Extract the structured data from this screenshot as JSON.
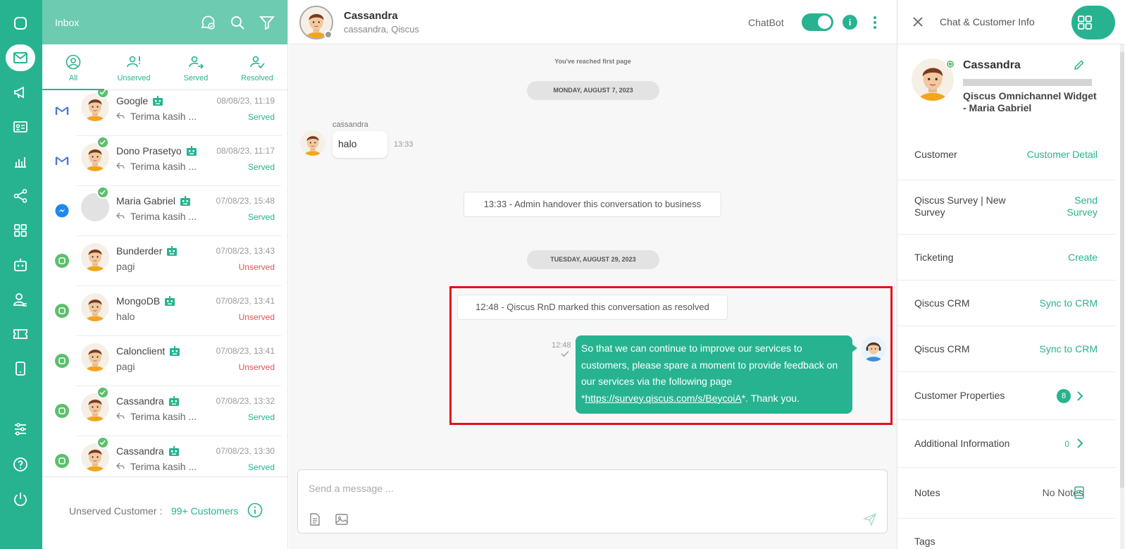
{
  "nav": {
    "items": [
      "chat-icon",
      "inbox-icon",
      "broadcast-icon",
      "contacts-icon",
      "analytics-icon",
      "integration-icon",
      "apps-icon",
      "bot-icon",
      "agent-icon",
      "ticket-icon",
      "mobile-icon",
      "settings-icon",
      "help-icon",
      "logout-icon"
    ]
  },
  "inbox": {
    "title": "Inbox",
    "tabs": [
      {
        "label": "All"
      },
      {
        "label": "Unserved"
      },
      {
        "label": "Served"
      },
      {
        "label": "Resolved"
      }
    ],
    "rooms": [
      {
        "name": "Google",
        "time": "08/08/23, 11:19",
        "preview": "Terima kasih ...",
        "status": "Served",
        "channel": "gmail",
        "resolved": true
      },
      {
        "name": "Dono Prasetyo",
        "time": "08/08/23, 11:17",
        "preview": "Terima kasih ...",
        "status": "Served",
        "channel": "gmail",
        "resolved": true
      },
      {
        "name": "Maria Gabriel",
        "time": "07/08/23, 15:48",
        "preview": "Terima kasih ...",
        "status": "Served",
        "channel": "messenger",
        "resolved": true
      },
      {
        "name": "Bunderder",
        "time": "07/08/23, 13:43",
        "preview": "pagi",
        "status": "Unserved",
        "channel": "qiscus",
        "resolved": false
      },
      {
        "name": "MongoDB",
        "time": "07/08/23, 13:41",
        "preview": "halo",
        "status": "Unserved",
        "channel": "qiscus",
        "resolved": false
      },
      {
        "name": "Calonclient",
        "time": "07/08/23, 13:41",
        "preview": "pagi",
        "status": "Unserved",
        "channel": "qiscus",
        "resolved": false
      },
      {
        "name": "Cassandra",
        "time": "07/08/23, 13:32",
        "preview": "Terima kasih ...",
        "status": "Served",
        "channel": "qiscus",
        "resolved": true
      },
      {
        "name": "Cassandra",
        "time": "07/08/23, 13:30",
        "preview": "Terima kasih ...",
        "status": "Served",
        "channel": "qiscus",
        "resolved": true
      }
    ],
    "footer_label": "Unserved Customer :",
    "footer_count": "99+ Customers"
  },
  "chat": {
    "name": "Cassandra",
    "subtitle": "cassandra, Qiscus",
    "chatbot_label": "ChatBot",
    "chatbot_enabled": true,
    "first_page": "You've reached first page",
    "date1": "MONDAY, AUGUST 7, 2023",
    "sender": "cassandra",
    "incoming_text": "halo",
    "incoming_time": "13:33",
    "system1": "13:33 - Admin handover this conversation to business",
    "date2": "TUESDAY, AUGUST 29, 2023",
    "system2": "12:48 - Qiscus RnD marked this conversation as resolved",
    "outgoing_time": "12:48",
    "outgoing_text_1": "So that we can continue to improve our services to customers, please spare a moment to provide feedback on our services via the following page *",
    "outgoing_link": "https://survey.qiscus.com/s/BeycoiA",
    "outgoing_text_2": "*. Thank you.",
    "composer_placeholder": "Send a message ..."
  },
  "panel": {
    "title": "Chat & Customer Info",
    "customer_name": "Cassandra",
    "channel": "Qiscus Omnichannel Widget - Maria Gabriel",
    "rows": [
      {
        "label": "Customer",
        "action": "Customer Detail"
      },
      {
        "label": "Qiscus Survey | New Survey",
        "action": "Send Survey"
      },
      {
        "label": "Ticketing",
        "action": "Create"
      },
      {
        "label": "Qiscus CRM",
        "action": "Sync to CRM"
      },
      {
        "label": "Qiscus CRM",
        "action": "Sync to CRM"
      },
      {
        "label": "Customer Properties",
        "badge": "8"
      },
      {
        "label": "Additional Information",
        "count": "0"
      },
      {
        "label": "Notes",
        "action": "No Notes"
      },
      {
        "label": "Tags"
      }
    ]
  },
  "colors": {
    "brand": "#27b38f",
    "header": "#6ccbb1",
    "unserved": "#e55353",
    "highlight": "#e3111d"
  }
}
